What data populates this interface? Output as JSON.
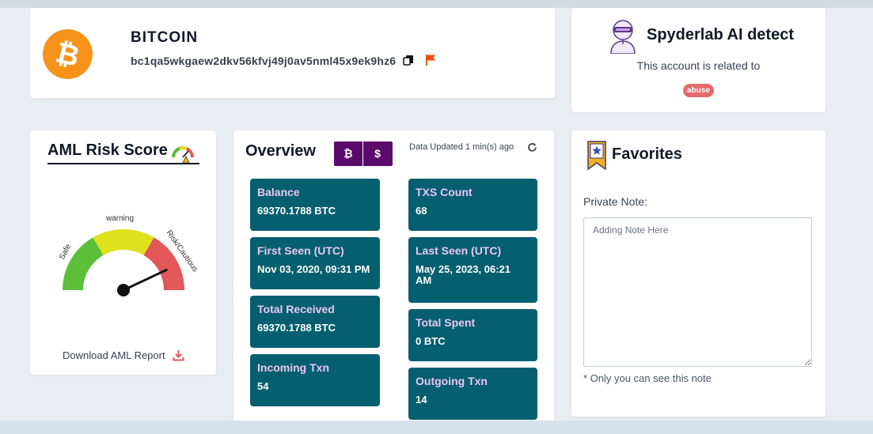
{
  "coin": {
    "name": "BITCOIN",
    "symbol_glyph": "₿",
    "address": "bc1qa5wkgaew2dkv56kfvj49j0av5nml45x9ek9hz6",
    "accent_color": "#f7931a",
    "copy_icon": "copy-icon",
    "flag_icon": "flag-icon"
  },
  "ai_detect": {
    "title": "Spyderlab AI detect",
    "subtitle": "This account is related to",
    "badge": "abuse",
    "badge_color": "#e56a6a"
  },
  "aml": {
    "title": "AML Risk Score",
    "gauge": {
      "zones": [
        "Safe",
        "warning",
        "Risk/Cautious"
      ],
      "zone_colors": [
        "#5bbf3a",
        "#dfe11c",
        "#e25757"
      ],
      "level": 0.86
    },
    "download_label": "Download AML Report"
  },
  "overview": {
    "title": "Overview",
    "currency_buttons": [
      "₿",
      "$"
    ],
    "updated": "Data Updated 1 min(s) ago",
    "stats": [
      {
        "label": "Balance",
        "value": "69370.1788 BTC"
      },
      {
        "label": "TXS Count",
        "value": "68"
      },
      {
        "label": "First Seen (UTC)",
        "value": "Nov 03, 2020, 09:31 PM"
      },
      {
        "label": "Last Seen (UTC)",
        "value": "May 25, 2023, 06:21 AM"
      },
      {
        "label": "Total Received",
        "value": "69370.1788 BTC"
      },
      {
        "label": "Total Spent",
        "value": "0 BTC"
      },
      {
        "label": "Incoming Txn",
        "value": "54"
      },
      {
        "label": "Outgoing Txn",
        "value": "14"
      }
    ],
    "tile_color": "#055f6f",
    "toggle_color": "#5a0a6b"
  },
  "favorites": {
    "title": "Favorites",
    "note_label": "Private Note:",
    "note_placeholder": "Adding Note Here",
    "footnote": "* Only you can see this note"
  }
}
